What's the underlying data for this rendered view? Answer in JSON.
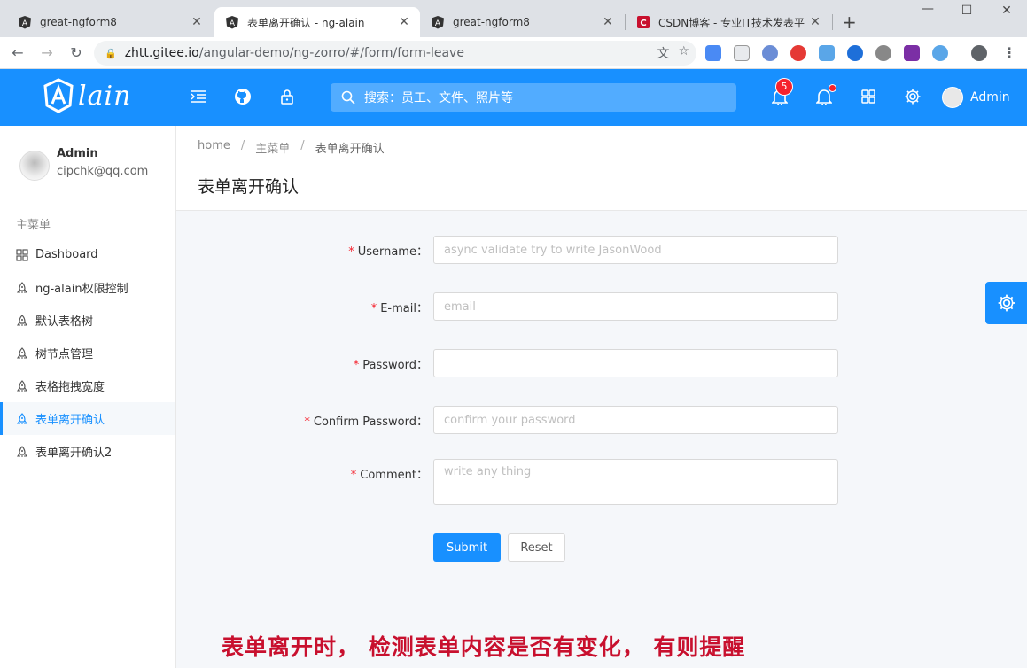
{
  "browser": {
    "tabs": [
      {
        "title": "great-ngform8",
        "active": false
      },
      {
        "title": "表单离开确认 - ng-alain",
        "active": true
      },
      {
        "title": "great-ngform8",
        "active": false
      },
      {
        "title": "CSDN博客 - 专业IT技术发表平",
        "active": false
      }
    ],
    "url_host": "zhtt.gitee.io",
    "url_path": "/angular-demo/ng-zorro/#/form/form-leave"
  },
  "header": {
    "logo_text": "lain",
    "search_placeholder": "搜索：员工、文件、照片等",
    "notification_count": "5",
    "user_name": "Admin",
    "colors": {
      "primary": "#1890ff",
      "badge": "#f5222d"
    }
  },
  "sidebar": {
    "user": {
      "name": "Admin",
      "email": "cipchk@qq.com"
    },
    "group_title": "主菜单",
    "items": [
      {
        "label": "Dashboard",
        "icon": "dashboard-icon"
      },
      {
        "label": "ng-alain权限控制",
        "icon": "rocket-icon"
      },
      {
        "label": "默认表格树",
        "icon": "rocket-icon"
      },
      {
        "label": "树节点管理",
        "icon": "rocket-icon"
      },
      {
        "label": "表格拖拽宽度",
        "icon": "rocket-icon"
      },
      {
        "label": "表单离开确认",
        "icon": "rocket-icon",
        "active": true
      },
      {
        "label": "表单离开确认2",
        "icon": "rocket-icon"
      }
    ]
  },
  "page": {
    "breadcrumb": [
      "home",
      "主菜单",
      "表单离开确认"
    ],
    "title": "表单离开确认"
  },
  "form": {
    "username": {
      "label": "Username",
      "placeholder": "async validate try to write JasonWood",
      "value": ""
    },
    "email": {
      "label": "E-mail",
      "placeholder": "email",
      "value": ""
    },
    "password": {
      "label": "Password",
      "placeholder": "",
      "value": ""
    },
    "confirm": {
      "label": "Confirm Password",
      "placeholder": "confirm your password",
      "value": ""
    },
    "comment": {
      "label": "Comment",
      "placeholder": "write any thing",
      "value": ""
    },
    "label_suffix": "：",
    "submit_label": "Submit",
    "reset_label": "Reset"
  },
  "caption": "表单离开时， 检测表单内容是否有变化， 有则提醒"
}
